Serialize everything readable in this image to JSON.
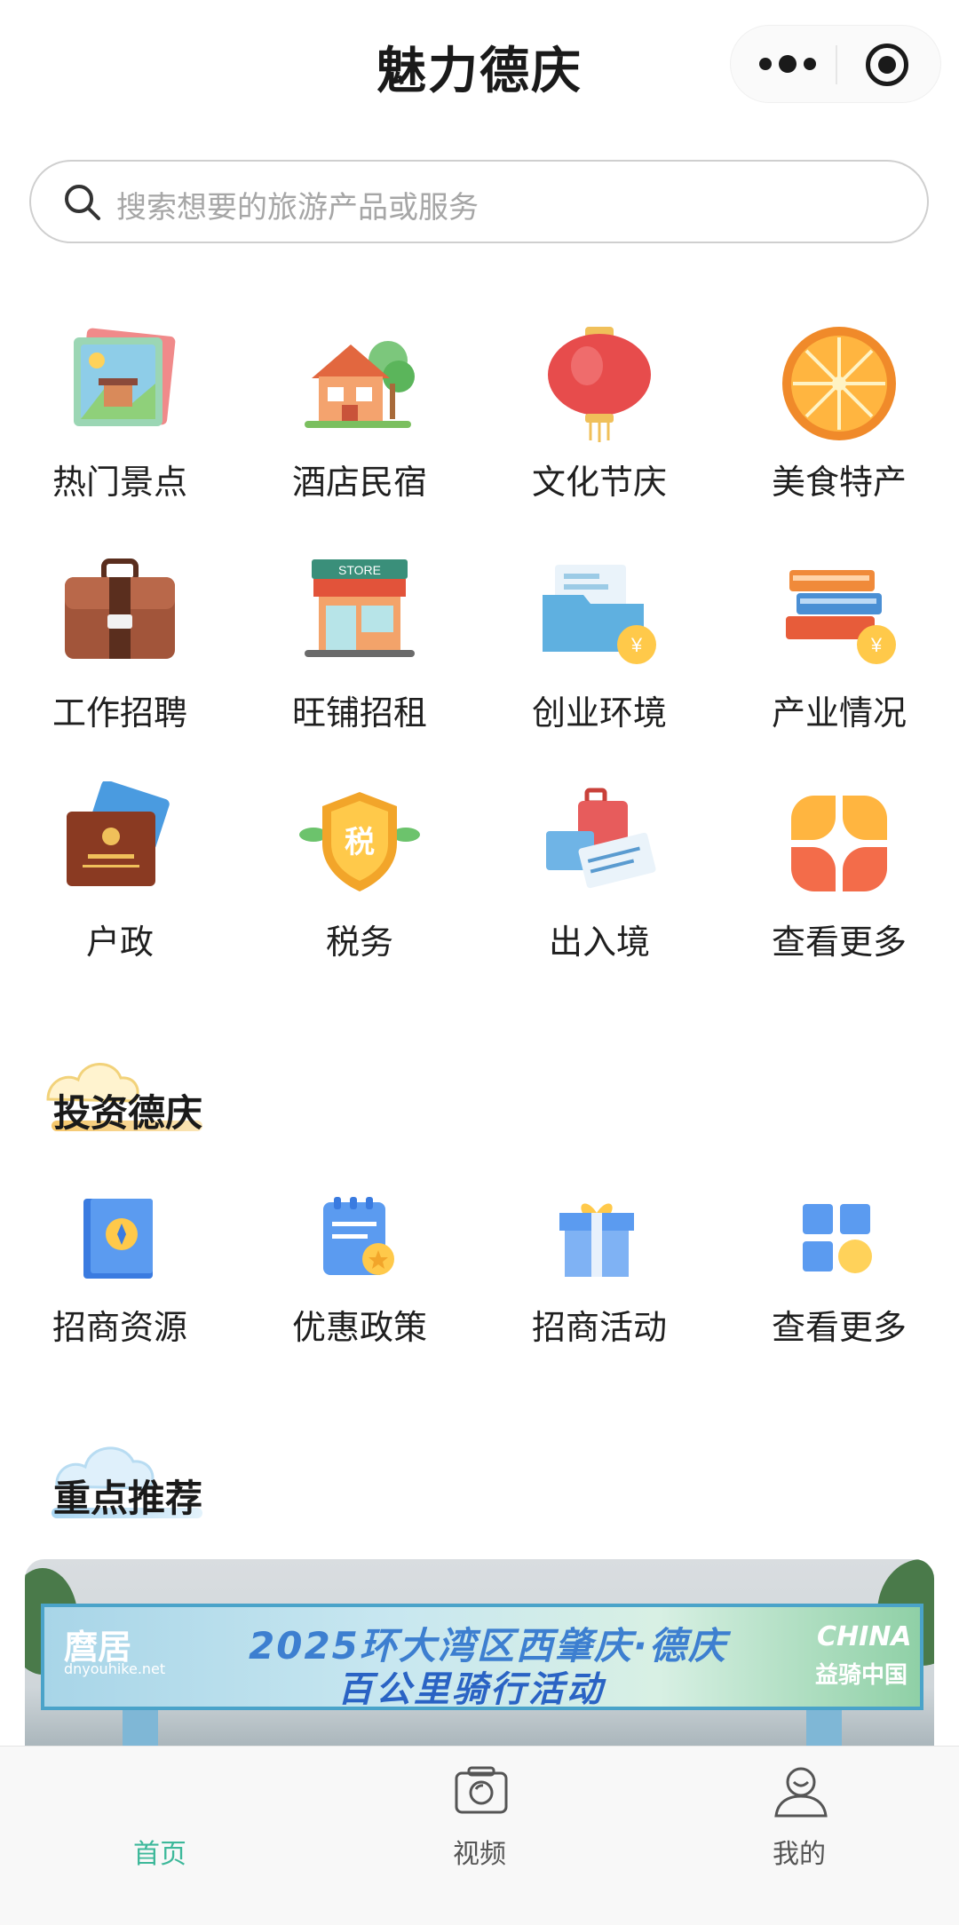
{
  "header": {
    "title": "魅力德庆",
    "more_icon": "more-dots-icon",
    "close_icon": "target-icon"
  },
  "search": {
    "placeholder": "搜索想要的旅游产品或服务"
  },
  "services": [
    {
      "label": "热门景点",
      "icon": "scenic-photo-icon"
    },
    {
      "label": "酒店民宿",
      "icon": "house-icon"
    },
    {
      "label": "文化节庆",
      "icon": "lantern-icon"
    },
    {
      "label": "美食特产",
      "icon": "orange-icon"
    },
    {
      "label": "工作招聘",
      "icon": "briefcase-icon"
    },
    {
      "label": "旺铺招租",
      "icon": "store-icon"
    },
    {
      "label": "创业环境",
      "icon": "folder-coin-icon"
    },
    {
      "label": "产业情况",
      "icon": "books-coin-icon"
    },
    {
      "label": "户政",
      "icon": "household-register-icon"
    },
    {
      "label": "税务",
      "icon": "tax-shield-icon"
    },
    {
      "label": "出入境",
      "icon": "luggage-icon"
    },
    {
      "label": "查看更多",
      "icon": "clover-grid-icon"
    }
  ],
  "store_sign": "STORE",
  "tax_char": "税",
  "invest": {
    "title": "投资德庆",
    "items": [
      {
        "label": "招商资源",
        "icon": "compass-book-icon"
      },
      {
        "label": "优惠政策",
        "icon": "policy-badge-icon"
      },
      {
        "label": "招商活动",
        "icon": "gift-box-icon"
      },
      {
        "label": "查看更多",
        "icon": "grid-more-icon"
      }
    ]
  },
  "recommend": {
    "title": "重点推荐",
    "banner": {
      "line1": "2025环大湾区西肇庆·德庆",
      "line2": "百公里骑行活动",
      "left_logo": "麿居",
      "left_logo_sub": "dnyouhike.net",
      "right_logo_top": "CHINA",
      "right_logo_bottom": "益骑中国"
    }
  },
  "tabbar": [
    {
      "label": "首页",
      "icon": "home-icon",
      "active": true
    },
    {
      "label": "视频",
      "icon": "camera-icon",
      "active": false
    },
    {
      "label": "我的",
      "icon": "user-icon",
      "active": false
    }
  ],
  "colors": {
    "accent": "#3db89a",
    "text": "#1a1a1a",
    "placeholder": "#a6a6a6"
  }
}
